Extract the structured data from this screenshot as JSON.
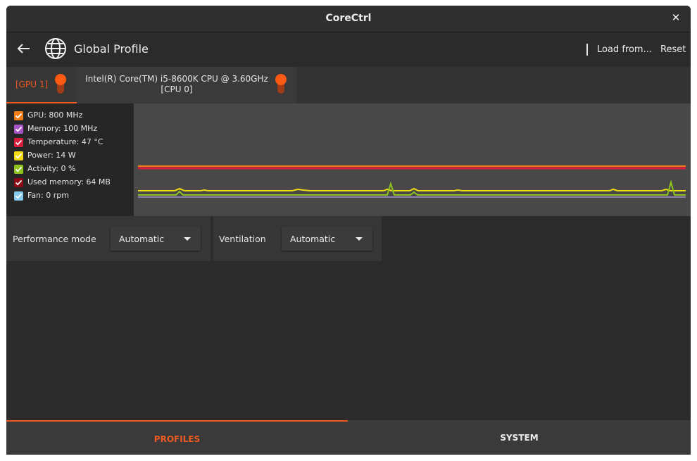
{
  "window": {
    "title": "CoreCtrl"
  },
  "header": {
    "profile_title": "Global Profile",
    "load_label": "Load from...",
    "reset_label": "Reset"
  },
  "tabs": [
    {
      "label": "[GPU 1]",
      "active": true
    },
    {
      "label_line1": "Intel(R) Core(TM) i5-8600K CPU @ 3.60GHz",
      "label_line2": "[CPU 0]",
      "active": false
    }
  ],
  "legend": [
    {
      "label": "GPU: 800 MHz",
      "color": "#f07d17",
      "checked": true
    },
    {
      "label": "Memory: 100 MHz",
      "color": "#a855c8",
      "checked": true
    },
    {
      "label": "Temperature: 47 °C",
      "color": "#d81e3c",
      "checked": true
    },
    {
      "label": "Power: 14 W",
      "color": "#f3dc13",
      "checked": true
    },
    {
      "label": "Activity: 0 %",
      "color": "#8fc31f",
      "checked": true
    },
    {
      "label": "Used memory: 64 MB",
      "color": "#8b0a16",
      "checked": true
    },
    {
      "label": "Fan: 0 rpm",
      "color": "#84c9ec",
      "checked": true
    }
  ],
  "controls": {
    "performance_label": "Performance mode",
    "performance_value": "Automatic",
    "ventilation_label": "Ventilation",
    "ventilation_value": "Automatic"
  },
  "bottom_tabs": [
    {
      "label": "PROFILES",
      "active": true
    },
    {
      "label": "SYSTEM",
      "active": false
    }
  ],
  "colors": {
    "accent": "#f15922"
  }
}
